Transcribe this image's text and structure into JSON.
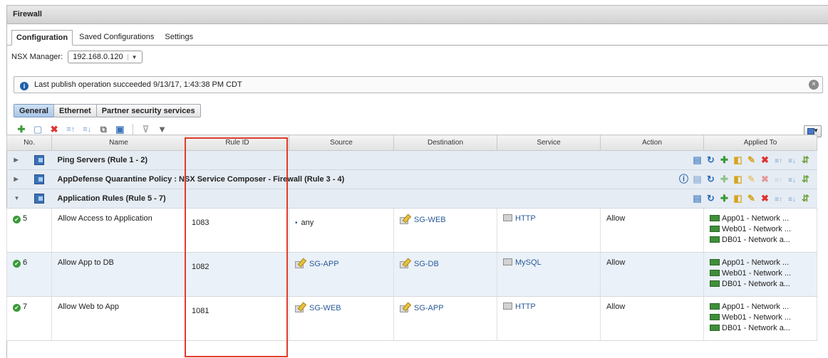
{
  "window": {
    "title": "Firewall"
  },
  "tabs": [
    {
      "label": "Configuration",
      "active": true
    },
    {
      "label": "Saved Configurations",
      "active": false
    },
    {
      "label": "Settings",
      "active": false
    }
  ],
  "nsx_manager": {
    "label": "NSX Manager:",
    "value": "192.168.0.120"
  },
  "info_bar": {
    "message": "Last publish operation succeeded 9/13/17, 1:43:38 PM CDT"
  },
  "subtabs": [
    {
      "label": "General",
      "active": true
    },
    {
      "label": "Ethernet",
      "active": false
    },
    {
      "label": "Partner security services",
      "active": false
    }
  ],
  "columns": [
    "No.",
    "Name",
    "Rule ID",
    "Source",
    "Destination",
    "Service",
    "Action",
    "Applied To"
  ],
  "sections": [
    {
      "name": "Ping Servers (Rule 1 - 2)",
      "expanded": false
    },
    {
      "name": "AppDefense Quarantine Policy : NSX Service Composer - Firewall (Rule 3 - 4)",
      "expanded": false
    },
    {
      "name": "Application Rules (Rule 5 - 7)",
      "expanded": true
    }
  ],
  "rules": [
    {
      "no": "5",
      "name": "Allow Access to Application",
      "rule_id": "1083",
      "source": "any",
      "destination": "SG-WEB",
      "service": "HTTP",
      "action": "Allow",
      "applied_to": [
        "App01 - Network ...",
        "Web01 - Network ...",
        "DB01 - Network a..."
      ]
    },
    {
      "no": "6",
      "name": "Allow App to DB",
      "rule_id": "1082",
      "source": "SG-APP",
      "destination": "SG-DB",
      "service": "MySQL",
      "action": "Allow",
      "applied_to": [
        "App01 - Network ...",
        "Web01 - Network ...",
        "DB01 - Network a..."
      ]
    },
    {
      "no": "7",
      "name": "Allow Web to App",
      "rule_id": "1081",
      "source": "SG-WEB",
      "destination": "SG-APP",
      "service": "HTTP",
      "action": "Allow",
      "applied_to": [
        "App01 - Network ...",
        "Web01 - Network ...",
        "DB01 - Network a..."
      ]
    }
  ],
  "colors": {
    "accent": "#2a5a99",
    "highlight": "#e13b2b",
    "ok": "#3a9a38"
  }
}
